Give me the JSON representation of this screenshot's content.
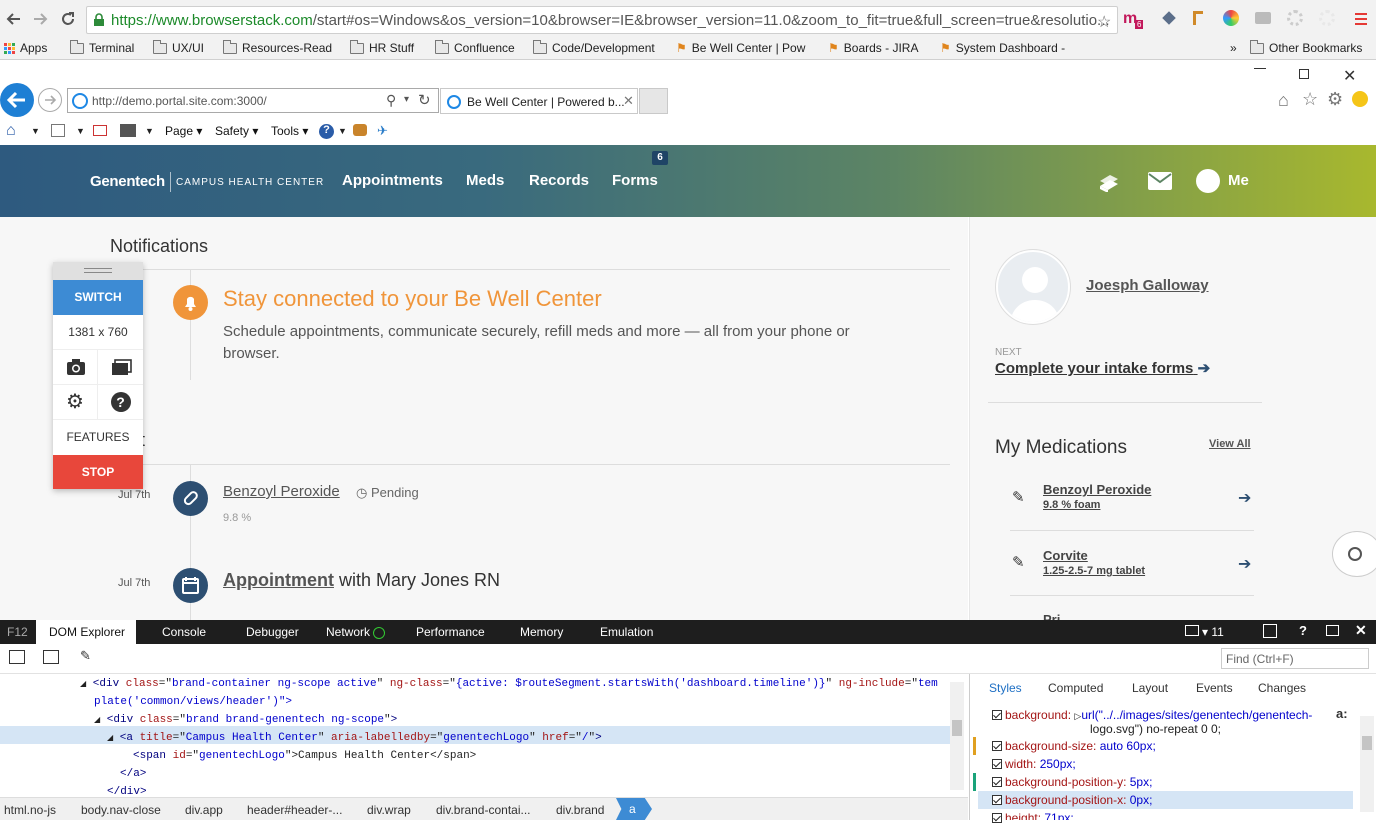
{
  "chrome": {
    "url_host": "https://www.browserstack.com",
    "url_rest": "/start#os=Windows&os_version=10&browser=IE&browser_version=11.0&zoom_to_fit=true&full_screen=true&resolutio...",
    "ext_badge": "6",
    "bookmarks": [
      "Apps",
      "Terminal",
      "UX/UI",
      "Resources-Read",
      "HR Stuff",
      "Confluence",
      "Code/Development",
      "Be Well Center | Pow",
      "Boards - JIRA",
      "System Dashboard -"
    ],
    "other_bookmarks": "Other Bookmarks",
    "overflow": "»"
  },
  "ie": {
    "address": "http://demo.portal.site.com:3000/",
    "tab_title": "Be Well Center | Powered b...",
    "menu": {
      "page": "Page",
      "safety": "Safety",
      "tools": "Tools"
    }
  },
  "site": {
    "logo": "Genentech",
    "logo_sub": "CAMPUS HEALTH CENTER",
    "nav": [
      "Appointments",
      "Meds",
      "Records",
      "Forms"
    ],
    "forms_badge": "6",
    "me": "Me",
    "brand_color": "#2e5a7f",
    "accent_color": "#f0953a"
  },
  "main": {
    "heading": "Notifications",
    "banner_title": "Stay connected to your Be Well Center",
    "banner_text": "Schedule appointments, communicate securely, refill meds and more — all from your phone or browser.",
    "partial_heading": "t",
    "timeline": [
      {
        "date": "Jul 7th",
        "title": "Benzoyl Peroxide",
        "status": "Pending",
        "sub": "9.8 %"
      },
      {
        "date": "Jul 7th",
        "title": "Appointment",
        "suffix": "with Mary Jones RN"
      }
    ]
  },
  "widget": {
    "switch": "SWITCH",
    "resolution": "1381 x 760",
    "features": "FEATURES",
    "stop": "STOP"
  },
  "aside": {
    "name": "Joesph Galloway",
    "next_label": "NEXT",
    "next_action": "Complete your intake forms",
    "meds_title": "My Medications",
    "view_all": "View All",
    "meds": [
      {
        "name": "Benzoyl Peroxide",
        "dose": "9.8 % foam"
      },
      {
        "name": "Corvite",
        "dose": "1.25-2.5-7 mg tablet"
      },
      {
        "name": "Pri...",
        "dose": ""
      }
    ]
  },
  "devtools": {
    "f12": "F12",
    "tabs": [
      "DOM Explorer",
      "Console",
      "Debugger",
      "Network",
      "Performance",
      "Memory",
      "Emulation"
    ],
    "doc_mode": "11",
    "find_placeholder": "Find (Ctrl+F)",
    "style_tabs": [
      "Styles",
      "Computed",
      "Layout",
      "Events",
      "Changes"
    ],
    "dom_lines": [
      {
        "tag": "<div ",
        "attrs": [
          [
            "class",
            "brand-container ng-scope active"
          ],
          [
            "ng-class",
            "{active: $routeSegment.startsWith('dashboard.timeline')}"
          ],
          [
            "ng-include",
            "tem"
          ]
        ]
      },
      {
        "text": "plate('common/views/header')\">"
      },
      {
        "tag": "<div ",
        "attrs": [
          [
            "class",
            "brand brand-genentech ng-scope"
          ]
        ]
      },
      {
        "tag": "<a ",
        "attrs": [
          [
            "title",
            "Campus Health Center"
          ],
          [
            "aria-labelledby",
            "genentechLogo"
          ],
          [
            "href",
            "/"
          ]
        ]
      },
      {
        "tag": "<span ",
        "attrs": [
          [
            "id",
            "genentechLogo"
          ]
        ],
        "inner": "Campus Health Center</span>"
      },
      {
        "text": "</a>"
      },
      {
        "text": "</div>"
      }
    ],
    "breadcrumbs": [
      "html.no-js",
      "body.nav-close",
      "div.app",
      "header#header-...",
      "div.wrap",
      "div.brand-contai...",
      "div.brand",
      "a"
    ],
    "styles": [
      {
        "prop": "background:",
        "val": "url(\"../../images/sites/genentech/genentech-"
      },
      {
        "prop": "",
        "val": "logo.svg\") no-repeat 0 0;"
      },
      {
        "prop": "background-size:",
        "val": "auto 60px;"
      },
      {
        "prop": "width:",
        "val": "250px;"
      },
      {
        "prop": "background-position-y:",
        "val": "5px;"
      },
      {
        "prop": "background-position-x:",
        "val": "0px;"
      },
      {
        "prop": "height:",
        "val": "71px;"
      }
    ]
  }
}
